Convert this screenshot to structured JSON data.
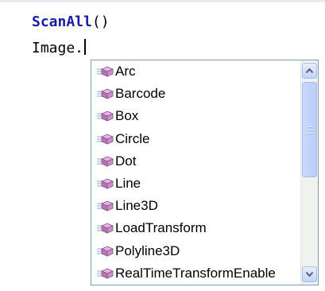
{
  "editor": {
    "line1_keyword": "ScanAll",
    "line1_suffix": "()",
    "line2_text": "Image."
  },
  "autocomplete": {
    "items": [
      {
        "label": "Arc",
        "icon": "method-icon"
      },
      {
        "label": "Barcode",
        "icon": "method-icon"
      },
      {
        "label": "Box",
        "icon": "method-icon"
      },
      {
        "label": "Circle",
        "icon": "method-icon"
      },
      {
        "label": "Dot",
        "icon": "method-icon"
      },
      {
        "label": "Line",
        "icon": "method-icon"
      },
      {
        "label": "Line3D",
        "icon": "method-icon"
      },
      {
        "label": "LoadTransform",
        "icon": "method-icon"
      },
      {
        "label": "Polyline3D",
        "icon": "method-icon"
      },
      {
        "label": "RealTimeTransformEnable",
        "icon": "method-icon"
      }
    ]
  },
  "colors": {
    "keyword": "#1a1aa8",
    "popup_border": "#7f9db9",
    "method_icon": "#b07ab0"
  }
}
